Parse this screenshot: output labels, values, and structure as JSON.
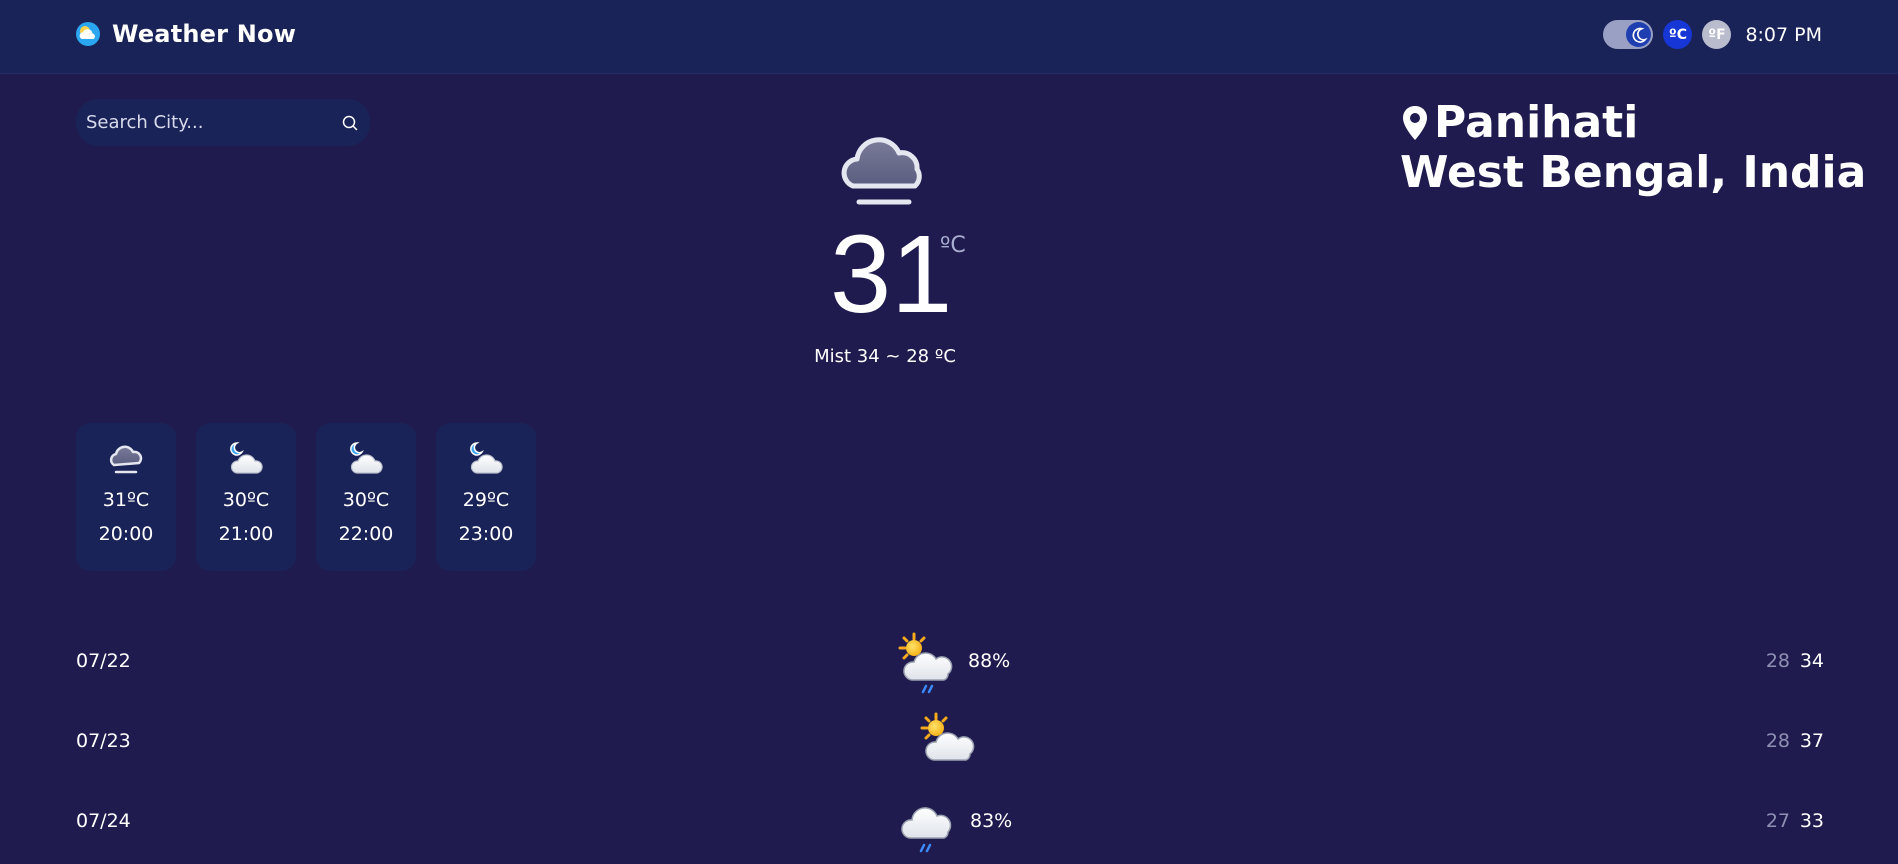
{
  "header": {
    "app_title": "Weather Now",
    "logo_icon": "cloud-logo-icon",
    "theme_toggle_icon": "moon-icon",
    "unit_c_label": "ºC",
    "unit_f_label": "ºF",
    "time": "8:07 PM",
    "colors": {
      "bar": "#1a2357",
      "unit_active": "#1636d6"
    }
  },
  "search": {
    "placeholder": "Search City...",
    "value": "",
    "icon": "search-icon"
  },
  "location": {
    "city": "Panihati",
    "region": "West Bengal, India",
    "icon": "map-pin-icon"
  },
  "current": {
    "icon": "fog-cloud-icon",
    "temperature": "31",
    "unit": "ºC",
    "summary": "Mist 34 ~ 28 ºC"
  },
  "hourly": [
    {
      "icon": "fog-cloud-icon",
      "temp": "31ºC",
      "time": "20:00"
    },
    {
      "icon": "moon-cloud-icon",
      "temp": "30ºC",
      "time": "21:00"
    },
    {
      "icon": "moon-cloud-icon",
      "temp": "30ºC",
      "time": "22:00"
    },
    {
      "icon": "moon-cloud-icon",
      "temp": "29ºC",
      "time": "23:00"
    }
  ],
  "daily": [
    {
      "date": "07/22",
      "icon": "sun-cloud-rain-icon",
      "precip": "88%",
      "low": "28",
      "high": "34"
    },
    {
      "date": "07/23",
      "icon": "sun-cloud-icon",
      "precip": "",
      "low": "28",
      "high": "37"
    },
    {
      "date": "07/24",
      "icon": "cloud-rain-icon",
      "precip": "83%",
      "low": "27",
      "high": "33"
    }
  ]
}
